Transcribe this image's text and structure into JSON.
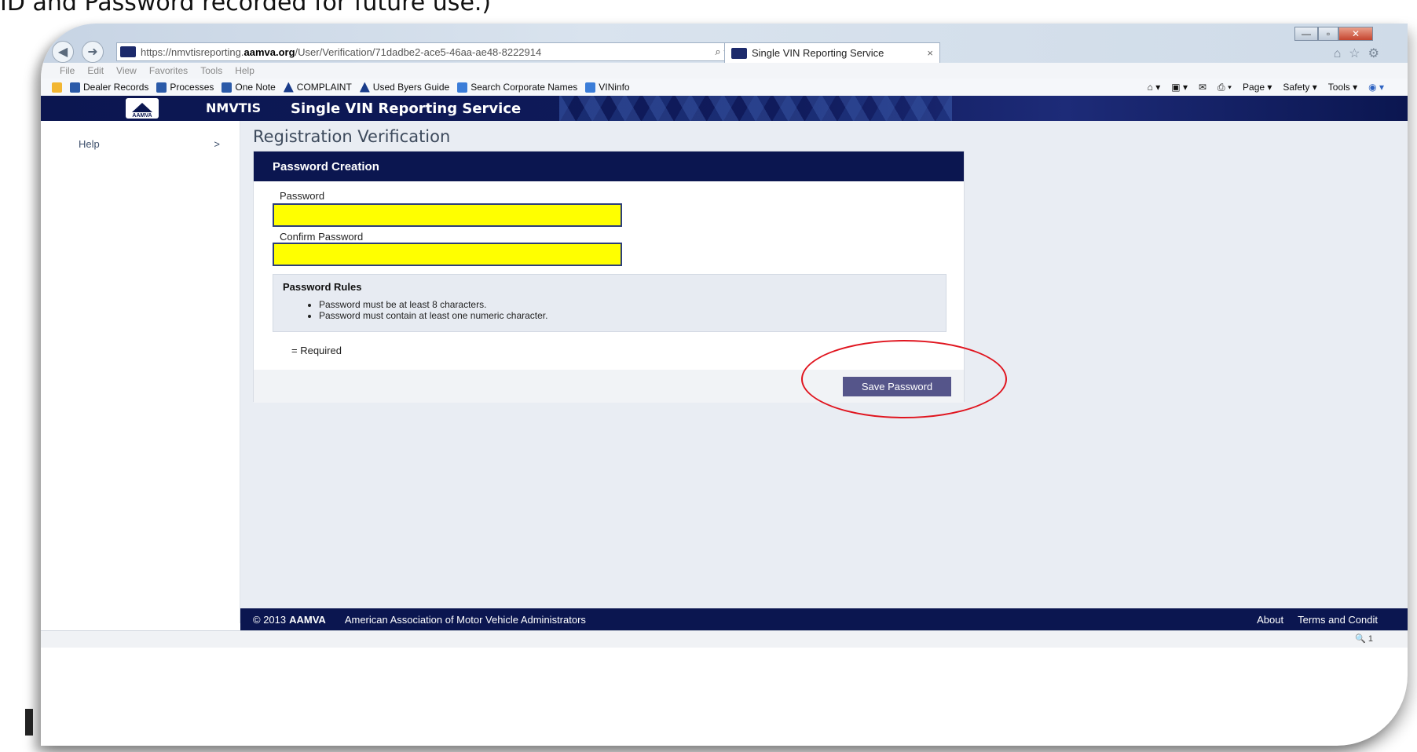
{
  "caption": "ID and Password recorded for future use.)",
  "browser": {
    "address_prefix": "https://nmvtisreporting.",
    "address_domain": "aamva.org",
    "address_path": "/User/Verification/71dadbe2-ace5-46aa-ae48-8222914",
    "address_icons": "⌕ ▾ 🔒 ↻",
    "tab_title": "Single VIN Reporting Service",
    "tab_close": "×",
    "win_minimize": "—",
    "win_maximize": "▫",
    "win_close": "✕",
    "top_icons": "⌂☆⚙",
    "menu": [
      "File",
      "Edit",
      "View",
      "Favorites",
      "Tools",
      "Help"
    ],
    "favorites": [
      {
        "label": "Dealer Records",
        "icon": "onenote-icon",
        "color": "#2b5aa8"
      },
      {
        "label": "Processes",
        "icon": "onenote-icon",
        "color": "#2b5aa8"
      },
      {
        "label": "One Note",
        "icon": "onenote-icon",
        "color": "#2b5aa8"
      },
      {
        "label": "COMPLAINT",
        "icon": "bookmark-icon",
        "color": "#1a3c8a"
      },
      {
        "label": "Used Byers Guide",
        "icon": "bookmark-icon",
        "color": "#1a3c8a"
      },
      {
        "label": "Search Corporate Names",
        "icon": "ie-page-icon",
        "color": "#3b7dd8"
      },
      {
        "label": "VINinfo",
        "icon": "ie-page-icon",
        "color": "#3b7dd8"
      }
    ],
    "commands": {
      "page": "Page ▾",
      "safety": "Safety ▾",
      "tools": "Tools ▾"
    }
  },
  "site": {
    "logo_text": "AAMVA",
    "nmvtis": "NMVTIS",
    "service_title": "Single VIN Reporting Service"
  },
  "nav": {
    "help_label": "Help",
    "help_arrow": ">"
  },
  "page": {
    "title": "Registration Verification",
    "panel_title": "Password Creation",
    "password_label": "Password",
    "password_value": "",
    "confirm_label": "Confirm Password",
    "confirm_value": "",
    "rules_title": "Password Rules",
    "rules": [
      "Password must be at least 8 characters.",
      "Password must contain at least one numeric character."
    ],
    "required_note": "= Required",
    "save_button": "Save Password"
  },
  "footer": {
    "copyright": "© 2013",
    "org_short": "AAMVA",
    "org_full": "American Association of Motor Vehicle Administrators",
    "about": "About",
    "terms": "Terms and Condit"
  },
  "status": {
    "zoom": "🔍 1"
  },
  "colors": {
    "navy": "#0b1650",
    "field_fill": "#ffff00",
    "button": "#55558a",
    "highlight": "#e0141e"
  }
}
